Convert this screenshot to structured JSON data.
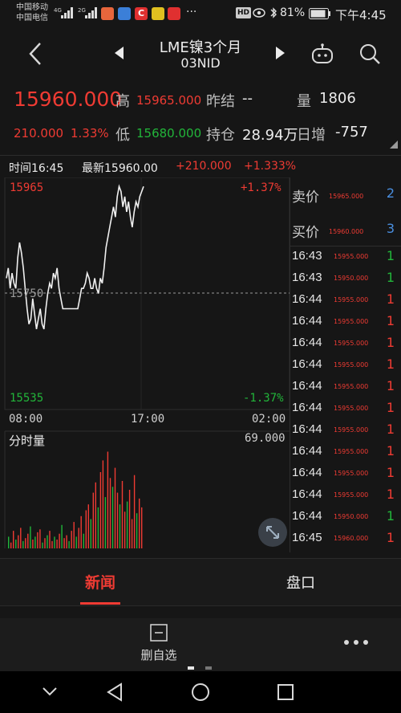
{
  "status": {
    "carrier1": "中国移动",
    "carrier2": "中国电信",
    "net1": "4G",
    "net2": "2G",
    "hd": "HD",
    "battery": "81%",
    "time": "下午4:45",
    "more": "···"
  },
  "header": {
    "title": "LME镍3个月",
    "subtitle": "03NID"
  },
  "quote": {
    "price": "15960.000",
    "high_label": "高",
    "high": "15965.000",
    "prev_label": "昨结",
    "prev": "--",
    "vol_label": "量",
    "vol": "1806",
    "change": "210.000",
    "change_pct": "1.33%",
    "low_label": "低",
    "low": "15680.000",
    "oi_label": "持仓",
    "oi": "28.94万",
    "daily_label": "日增",
    "daily": "-757"
  },
  "chart_header": {
    "time": "时间16:45",
    "latest": "最新15960.00",
    "change": "+210.000",
    "pct": "+1.333%"
  },
  "chart_data": {
    "type": "line",
    "price_axis": {
      "top": "15965",
      "mid": "15750",
      "bottom": "15535"
    },
    "pct_axis": {
      "top": "+1.37%",
      "bottom": "-1.37%"
    },
    "x_ticks": [
      "08:00",
      "17:00",
      "02:00"
    ],
    "ylim": [
      15535,
      15965
    ],
    "series": [
      {
        "values": [
          15780,
          15800,
          15760,
          15790,
          15770,
          15760,
          15820,
          15850,
          15830,
          15800,
          15760,
          15720,
          15690,
          15700,
          15740,
          15710,
          15680,
          15700,
          15720,
          15690,
          15680,
          15720,
          15750,
          15770,
          15760,
          15790,
          15780,
          15800,
          15760,
          15740,
          15720,
          15720,
          15720,
          15720,
          15720,
          15720,
          15720,
          15720,
          15720,
          15740,
          15760,
          15760,
          15770,
          15790,
          15780,
          15760,
          15760,
          15780,
          15760,
          15750,
          15780,
          15770,
          15800,
          15840,
          15860,
          15880,
          15900,
          15920,
          15900,
          15940,
          15960,
          15950,
          15920,
          15940,
          15910,
          15930,
          15900,
          15880,
          15910,
          15930,
          15920,
          15940,
          15950,
          15960
        ]
      }
    ],
    "volume": {
      "label": "分时量",
      "max": "69.000",
      "bars": [
        {
          "v": 8,
          "c": "green"
        },
        {
          "v": 4,
          "c": "red"
        },
        {
          "v": 12,
          "c": "red"
        },
        {
          "v": 6,
          "c": "green"
        },
        {
          "v": 9,
          "c": "red"
        },
        {
          "v": 14,
          "c": "red"
        },
        {
          "v": 5,
          "c": "green"
        },
        {
          "v": 7,
          "c": "red"
        },
        {
          "v": 10,
          "c": "red"
        },
        {
          "v": 15,
          "c": "green"
        },
        {
          "v": 6,
          "c": "red"
        },
        {
          "v": 8,
          "c": "green"
        },
        {
          "v": 11,
          "c": "red"
        },
        {
          "v": 13,
          "c": "red"
        },
        {
          "v": 4,
          "c": "green"
        },
        {
          "v": 7,
          "c": "red"
        },
        {
          "v": 9,
          "c": "green"
        },
        {
          "v": 12,
          "c": "red"
        },
        {
          "v": 5,
          "c": "red"
        },
        {
          "v": 8,
          "c": "green"
        },
        {
          "v": 6,
          "c": "red"
        },
        {
          "v": 10,
          "c": "red"
        },
        {
          "v": 16,
          "c": "green"
        },
        {
          "v": 7,
          "c": "red"
        },
        {
          "v": 9,
          "c": "red"
        },
        {
          "v": 5,
          "c": "green"
        },
        {
          "v": 12,
          "c": "red"
        },
        {
          "v": 18,
          "c": "red"
        },
        {
          "v": 8,
          "c": "green"
        },
        {
          "v": 14,
          "c": "red"
        },
        {
          "v": 22,
          "c": "red"
        },
        {
          "v": 10,
          "c": "green"
        },
        {
          "v": 26,
          "c": "red"
        },
        {
          "v": 30,
          "c": "red"
        },
        {
          "v": 20,
          "c": "green"
        },
        {
          "v": 38,
          "c": "red"
        },
        {
          "v": 45,
          "c": "red"
        },
        {
          "v": 28,
          "c": "green"
        },
        {
          "v": 52,
          "c": "red"
        },
        {
          "v": 60,
          "c": "red"
        },
        {
          "v": 35,
          "c": "green"
        },
        {
          "v": 66,
          "c": "red"
        },
        {
          "v": 48,
          "c": "red"
        },
        {
          "v": 42,
          "c": "green"
        },
        {
          "v": 55,
          "c": "red"
        },
        {
          "v": 38,
          "c": "red"
        },
        {
          "v": 30,
          "c": "green"
        },
        {
          "v": 46,
          "c": "red"
        },
        {
          "v": 25,
          "c": "red"
        },
        {
          "v": 32,
          "c": "green"
        },
        {
          "v": 40,
          "c": "red"
        },
        {
          "v": 20,
          "c": "red"
        },
        {
          "v": 50,
          "c": "red"
        },
        {
          "v": 24,
          "c": "green"
        },
        {
          "v": 34,
          "c": "red"
        },
        {
          "v": 28,
          "c": "red"
        }
      ]
    }
  },
  "orderbook": {
    "sell_label": "卖价",
    "sell_price": "15965.000",
    "sell_vol": "2",
    "buy_label": "买价",
    "buy_price": "15960.000",
    "buy_vol": "3",
    "trades": [
      {
        "time": "16:43",
        "price": "15955.000",
        "vol": "1",
        "c": "green"
      },
      {
        "time": "16:43",
        "price": "15950.000",
        "vol": "1",
        "c": "green"
      },
      {
        "time": "16:44",
        "price": "15955.000",
        "vol": "1",
        "c": "red"
      },
      {
        "time": "16:44",
        "price": "15955.000",
        "vol": "1",
        "c": "red"
      },
      {
        "time": "16:44",
        "price": "15955.000",
        "vol": "1",
        "c": "red"
      },
      {
        "time": "16:44",
        "price": "15955.000",
        "vol": "1",
        "c": "red"
      },
      {
        "time": "16:44",
        "price": "15955.000",
        "vol": "1",
        "c": "red"
      },
      {
        "time": "16:44",
        "price": "15955.000",
        "vol": "1",
        "c": "red"
      },
      {
        "time": "16:44",
        "price": "15955.000",
        "vol": "1",
        "c": "red"
      },
      {
        "time": "16:44",
        "price": "15955.000",
        "vol": "1",
        "c": "red"
      },
      {
        "time": "16:44",
        "price": "15955.000",
        "vol": "1",
        "c": "red"
      },
      {
        "time": "16:44",
        "price": "15955.000",
        "vol": "1",
        "c": "red"
      },
      {
        "time": "16:44",
        "price": "15950.000",
        "vol": "1",
        "c": "green"
      },
      {
        "time": "16:45",
        "price": "15960.000",
        "vol": "1",
        "c": "red"
      }
    ]
  },
  "tabs": {
    "news": "新闻",
    "market": "盘口"
  },
  "bottom": {
    "remove": "删自选"
  },
  "colors": {
    "red": "#ef3b33",
    "green": "#22b53a",
    "bg": "#161616"
  }
}
